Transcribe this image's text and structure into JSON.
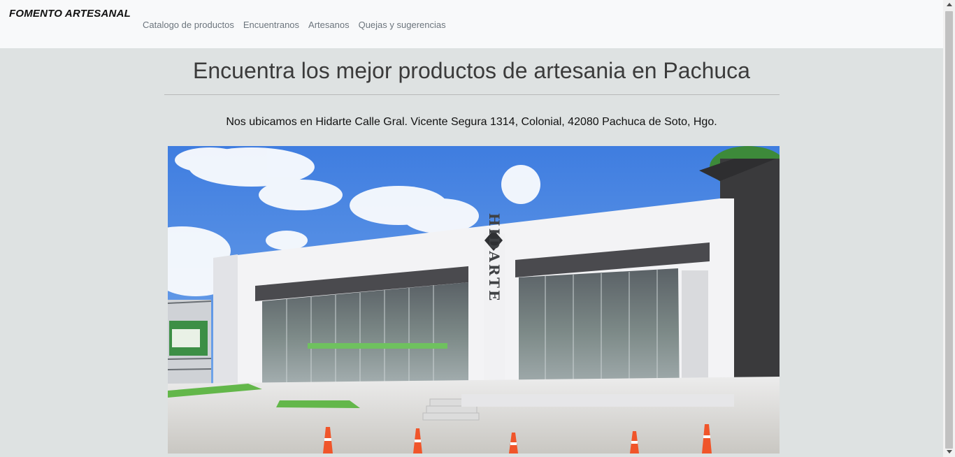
{
  "navbar": {
    "brand": "FOMENTO ARTESANAL",
    "links": [
      {
        "label": "Catalogo de productos"
      },
      {
        "label": "Encuentranos"
      },
      {
        "label": "Artesanos"
      },
      {
        "label": "Quejas y sugerencias"
      }
    ]
  },
  "main": {
    "heading": "Encuentra los mejor productos de artesania en Pachuca",
    "address": "Nos ubicamos en Hidarte Calle Gral. Vicente Segura 1314, Colonial, 42080 Pachuca de Soto, Hgo.",
    "storefront_photo": {
      "sign_text": "HIDARTE",
      "sky_color": "#4a86e0",
      "wall_color": "#f3f3f5",
      "awning_color": "#4a4a4e",
      "cone_color": "#f0552a"
    }
  },
  "scrollbar": {
    "up_icon": "scroll-up-arrow-icon",
    "down_icon": "scroll-down-arrow-icon"
  }
}
